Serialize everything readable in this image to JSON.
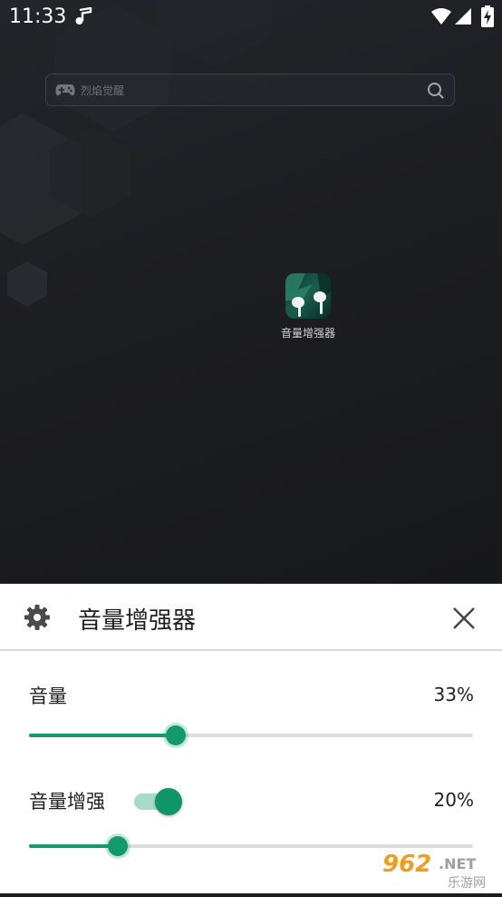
{
  "status_bar": {
    "time": "11:33"
  },
  "search": {
    "placeholder": "烈焰觉醒"
  },
  "app_icon": {
    "label": "音量增强器"
  },
  "sheet": {
    "title": "音量增强器",
    "volume": {
      "label": "音量",
      "value_text": "33%",
      "value": 0.33
    },
    "boost": {
      "label": "音量增强",
      "value_text": "20%",
      "value": 0.2,
      "enabled": true
    }
  },
  "watermark": {
    "brand": "962.NET",
    "sub": "乐游网"
  },
  "colors": {
    "accent": "#119a6a",
    "accent_light": "#a9dcc6",
    "track": "#dcdcdc",
    "background": "#1b1c1f"
  }
}
